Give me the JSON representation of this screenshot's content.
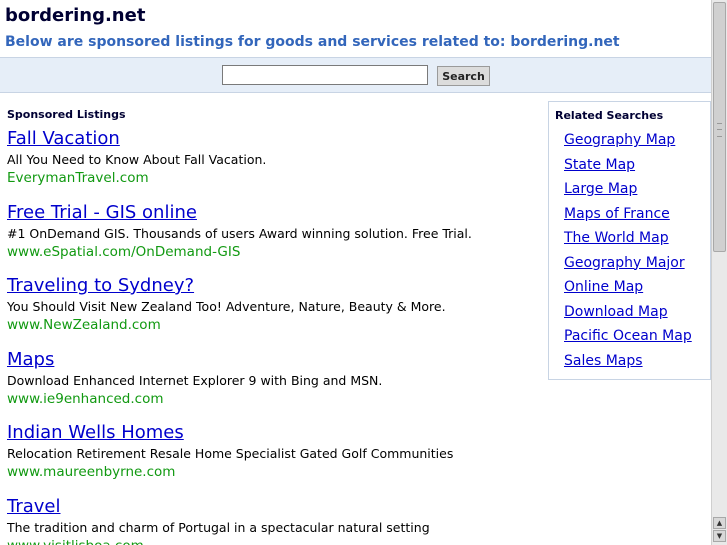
{
  "header": {
    "site_title": "bordering.net",
    "tagline": "Below are sponsored listings for goods and services related to: bordering.net"
  },
  "search": {
    "value": "",
    "button_label": "Search"
  },
  "listings_heading": "Sponsored Listings",
  "listings": [
    {
      "title": "Fall Vacation",
      "desc": "All You Need to Know About Fall Vacation.",
      "url": "EverymanTravel.com"
    },
    {
      "title": "Free Trial - GIS online",
      "desc": "#1 OnDemand GIS. Thousands of users Award winning solution. Free Trial.",
      "url": "www.eSpatial.com/OnDemand-GIS"
    },
    {
      "title": "Traveling to Sydney?",
      "desc": "You Should Visit New Zealand Too! Adventure, Nature, Beauty & More.",
      "url": "www.NewZealand.com"
    },
    {
      "title": "Maps",
      "desc": "Download Enhanced Internet Explorer 9 with Bing and MSN.",
      "url": "www.ie9enhanced.com"
    },
    {
      "title": "Indian Wells Homes",
      "desc": "Relocation Retirement Resale Home Specialist Gated Golf Communities",
      "url": "www.maureenbyrne.com"
    },
    {
      "title": "Travel",
      "desc": "The tradition and charm of Portugal in a spectacular natural setting",
      "url": "www.visitlisboa.com"
    }
  ],
  "related": {
    "heading": "Related Searches",
    "items": [
      "Geography Map",
      "State Map",
      "Large Map",
      "Maps of France",
      "The World Map",
      "Geography Major",
      "Online Map",
      "Download Map",
      "Pacific Ocean Map",
      "Sales Maps"
    ]
  },
  "scrollbar": {
    "up_icon": "arrow-up-icon",
    "down_icon": "arrow-down-icon"
  }
}
